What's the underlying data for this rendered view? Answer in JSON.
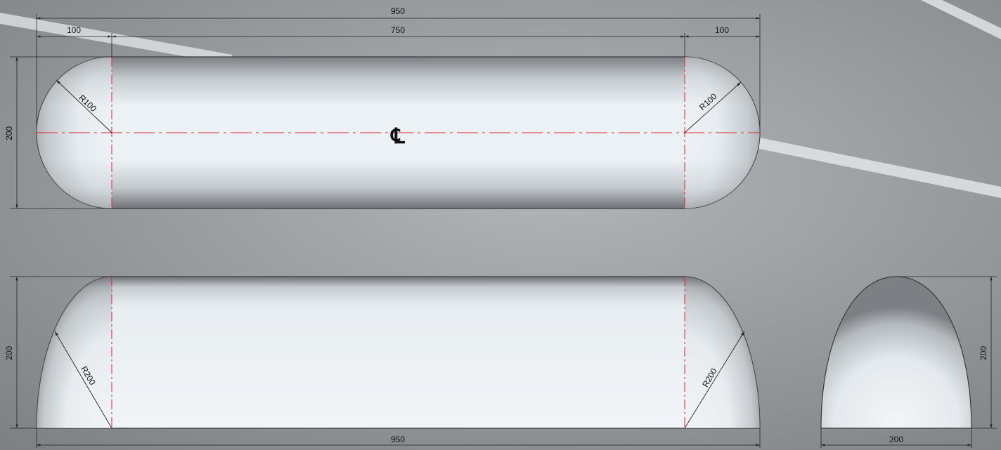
{
  "drawing": {
    "plan_view": {
      "overall_length": "950",
      "left_end": "100",
      "middle_length": "750",
      "right_end": "100",
      "height": "200",
      "left_radius": "R100",
      "right_radius": "R100",
      "centerline_symbol": "℄"
    },
    "side_view": {
      "height": "200",
      "left_radius": "R200",
      "right_radius": "R200",
      "overall_length": "950"
    },
    "end_view": {
      "height": "200",
      "width": "200"
    }
  },
  "colors": {
    "background": "#8f9294",
    "body_light": "#eef3f7",
    "body_dark": "#74787c",
    "outline": "#3a3c3e",
    "centerline": "#e0242a",
    "dimension": "#222222"
  }
}
